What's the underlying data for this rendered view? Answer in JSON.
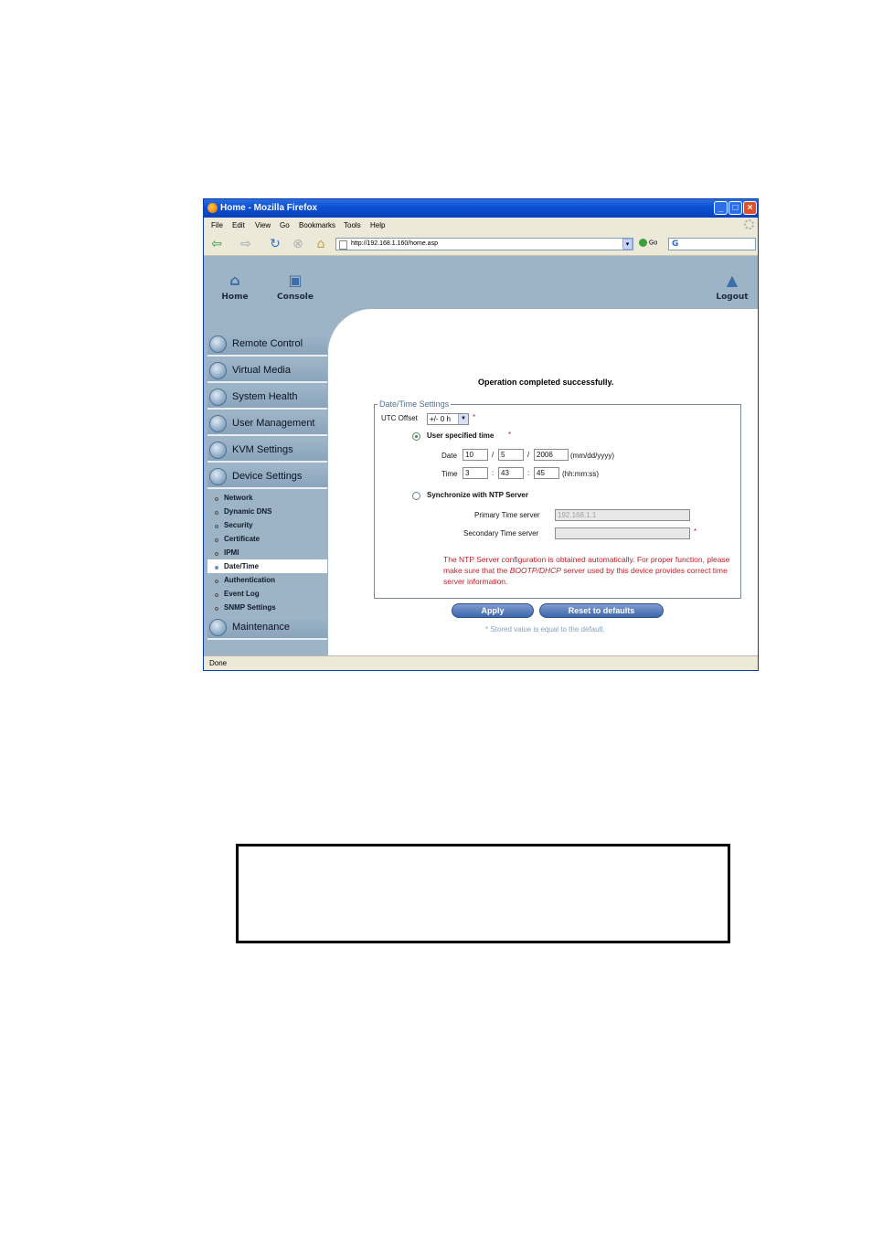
{
  "window": {
    "title": "Home - Mozilla Firefox",
    "status": "Done"
  },
  "menu": [
    "File",
    "Edit",
    "View",
    "Go",
    "Bookmarks",
    "Tools",
    "Help"
  ],
  "nav": {
    "url": "http://192.168.1.160/home.asp",
    "go_label": "Go",
    "search_icon": "G"
  },
  "topnav": {
    "home": "Home",
    "console": "Console",
    "logout": "Logout"
  },
  "sidebar": {
    "items": [
      {
        "label": "Remote Control",
        "icon": "remote-control-icon"
      },
      {
        "label": "Virtual Media",
        "icon": "virtual-media-icon"
      },
      {
        "label": "System Health",
        "icon": "system-health-icon"
      },
      {
        "label": "User Management",
        "icon": "user-management-icon"
      },
      {
        "label": "KVM Settings",
        "icon": "kvm-settings-icon"
      },
      {
        "label": "Device Settings",
        "icon": "device-settings-icon"
      }
    ],
    "subitems": [
      "Network",
      "Dynamic DNS",
      "Security",
      "Certificate",
      "IPMI",
      "Date/Time",
      "Authentication",
      "Event Log",
      "SNMP Settings"
    ],
    "active_subitem": "Date/Time",
    "maintenance": "Maintenance"
  },
  "main": {
    "message": "Operation completed successfully.",
    "legend": "Date/Time Settings",
    "utc_label": "UTC Offset",
    "utc_value": "+/- 0 h",
    "asterisk": "*",
    "user_time_label": "User specified time",
    "date_label": "Date",
    "date_month": "10",
    "date_day": "5",
    "date_year": "2006",
    "date_sep": "/",
    "date_format": "(mm/dd/yyyy)",
    "time_label": "Time",
    "time_h": "3",
    "time_m": "43",
    "time_s": "45",
    "time_sep": ":",
    "time_format": "(hh:mm:ss)",
    "ntp_label": "Synchronize with NTP Server",
    "primary_label": "Primary Time server",
    "primary_value": "192.168.1.1",
    "secondary_label": "Secondary Time server",
    "secondary_value": "",
    "note_part1": "The NTP Server configuration is obtained automatically. For proper function, please make sure that the ",
    "note_italic": "BOOTP/DHCP",
    "note_part2": " server used by this device provides correct time server information.",
    "apply": "Apply",
    "reset": "Reset to defaults",
    "stored_note": "* Stored value is equal to the default."
  },
  "colors": {
    "accent": "#9db3c6",
    "note_red": "#c0202a",
    "title_blue": "#0a4fd3"
  }
}
